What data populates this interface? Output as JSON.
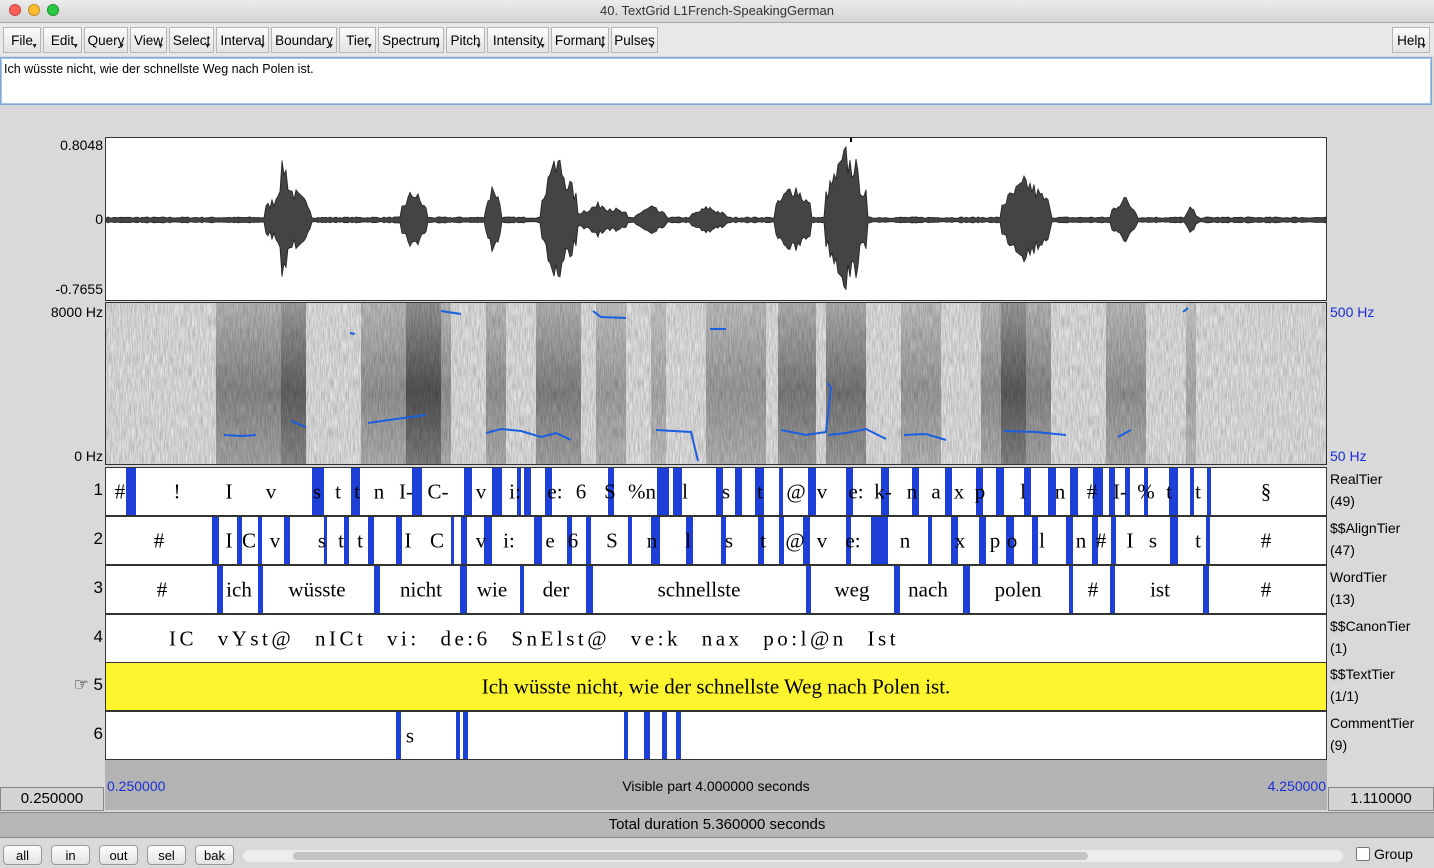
{
  "window": {
    "title": "40. TextGrid L1French-SpeakingGerman"
  },
  "menus": {
    "file": "File",
    "edit": "Edit",
    "query": "Query",
    "view": "View",
    "select": "Select",
    "interval": "Interval",
    "boundary": "Boundary",
    "tier": "Tier",
    "spectrum": "Spectrum",
    "pitch": "Pitch",
    "intensity": "Intensity",
    "formant": "Formant",
    "pulses": "Pulses",
    "help": "Help"
  },
  "text_field": "Ich wüsste nicht, wie der schnellste Weg nach Polen ist.",
  "waveform": {
    "max": "0.8048",
    "zero": "0",
    "min": "-0.7655"
  },
  "spectrogram": {
    "top": "8000 Hz",
    "bottom": "0 Hz",
    "pitch_top": "500 Hz",
    "pitch_bottom": "50 Hz"
  },
  "tiers": [
    {
      "num": "1",
      "name": "RealTier",
      "count": "(49)",
      "labels": [
        "#",
        "!",
        "I",
        "v",
        "s",
        "t",
        "t",
        "n",
        "I-",
        "C-",
        "v",
        "i:",
        "e:",
        "6",
        "S",
        "%n",
        "l",
        "s",
        "t",
        "@",
        "v",
        "e:",
        "k-",
        "n",
        "a",
        "x",
        "p",
        "l",
        "n",
        "#",
        "I-",
        "%",
        "t",
        "t",
        "§"
      ]
    },
    {
      "num": "2",
      "name": "$$AlignTier",
      "count": "(47)",
      "labels": [
        "#",
        "I",
        "C",
        "v",
        "s",
        "t",
        "t",
        "I",
        "C",
        "v",
        "i:",
        "e",
        "6",
        "S",
        "n",
        "l",
        "s",
        "t",
        "@",
        "v",
        "e:",
        "n",
        "x",
        "p",
        "o",
        "l",
        "n",
        "#",
        "I",
        "s",
        "t",
        "#"
      ]
    },
    {
      "num": "3",
      "name": "WordTier",
      "count": "(13)",
      "labels": [
        "#",
        "ich",
        "wüsste",
        "nicht",
        "wie",
        "der",
        "schnellste",
        "weg",
        "nach",
        "polen",
        "#",
        "ist",
        "#"
      ]
    },
    {
      "num": "4",
      "name": "$$CanonTier",
      "count": "(1)",
      "labels": [
        "IC vYst@ nICt vi: de:6 SnElst@ ve:k nax po:l@n Ist"
      ]
    },
    {
      "num": "5",
      "name": "$$TextTier",
      "count": "(1/1)",
      "marker": "☞",
      "labels": [
        "Ich wüsste nicht, wie der schnellste Weg nach Polen ist."
      ]
    },
    {
      "num": "6",
      "name": "CommentTier",
      "count": "(9)",
      "labels": [
        "s"
      ]
    }
  ],
  "view": {
    "visible_start": "0.250000",
    "visible_end": "4.250000",
    "visible_label": "Visible part 4.000000 seconds",
    "window_start": "0.250000",
    "window_end": "1.110000",
    "total": "Total duration 5.360000 seconds"
  },
  "buttons": {
    "all": "all",
    "in": "in",
    "out": "out",
    "sel": "sel",
    "bak": "bak"
  },
  "group": {
    "label": "Group",
    "checked": false
  },
  "colors": {
    "boundary": "#1e3fd8",
    "selected_tier": "#fff52e",
    "pitch": "#1a5fe0",
    "red": "#e0271b"
  }
}
